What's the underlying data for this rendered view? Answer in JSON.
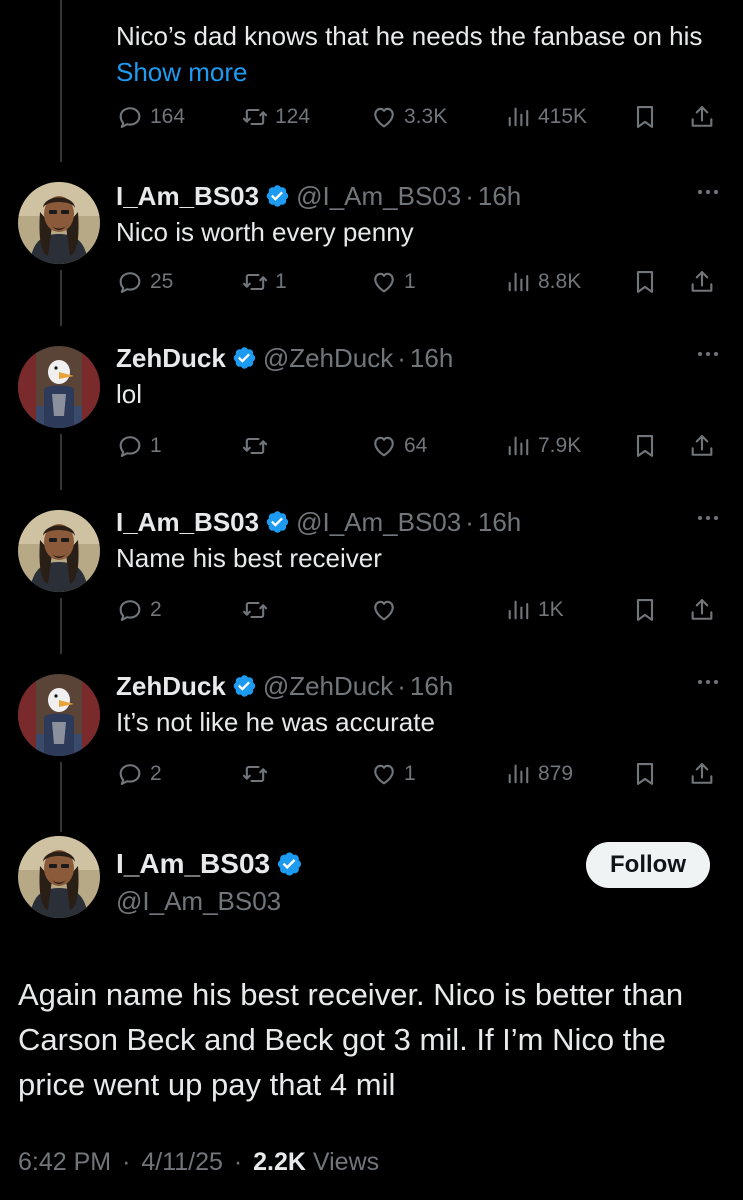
{
  "top_reply": {
    "text": "Nico’s dad knows that he needs the fanbase on his",
    "show_more": "Show more",
    "replies": "164",
    "reposts": "124",
    "likes": "3.3K",
    "views": "415K"
  },
  "replies": [
    {
      "name": "I_Am_BS03",
      "handle": "@I_Am_BS03",
      "time": "16h",
      "text": "Nico is worth every penny",
      "replies": "25",
      "reposts": "1",
      "likes": "1",
      "views": "8.8K"
    },
    {
      "name": "ZehDuck",
      "handle": "@ZehDuck",
      "time": "16h",
      "text": "lol",
      "replies": "1",
      "reposts": "",
      "likes": "64",
      "views": "7.9K"
    },
    {
      "name": "I_Am_BS03",
      "handle": "@I_Am_BS03",
      "time": "16h",
      "text": "Name his best receiver",
      "replies": "2",
      "reposts": "",
      "likes": "",
      "views": "1K"
    },
    {
      "name": "ZehDuck",
      "handle": "@ZehDuck",
      "time": "16h",
      "text": "It’s not like he was accurate",
      "replies": "2",
      "reposts": "",
      "likes": "1",
      "views": "879"
    }
  ],
  "separator": "·",
  "main_post": {
    "name": "I_Am_BS03",
    "handle": "@I_Am_BS03",
    "follow_label": "Follow",
    "text": "Again name his best receiver. Nico is better than Carson Beck and Beck got 3 mil. If I’m Nico the price went up pay that 4 mil",
    "time": "6:42 PM",
    "date": "4/11/25",
    "views_count": "2.2K",
    "views_label": "Views"
  },
  "icons": {
    "reply": "reply-icon",
    "repost": "repost-icon",
    "like": "like-icon",
    "views": "views-icon",
    "bookmark": "bookmark-icon",
    "share": "share-icon",
    "verified": "verified-badge-icon",
    "more": "more-options-icon"
  },
  "colors": {
    "background": "#000000",
    "text": "#e7e9ea",
    "secondary": "#71767b",
    "link": "#1d9bf0",
    "verified": "#1d9bf0",
    "follow_bg": "#eff3f4"
  }
}
